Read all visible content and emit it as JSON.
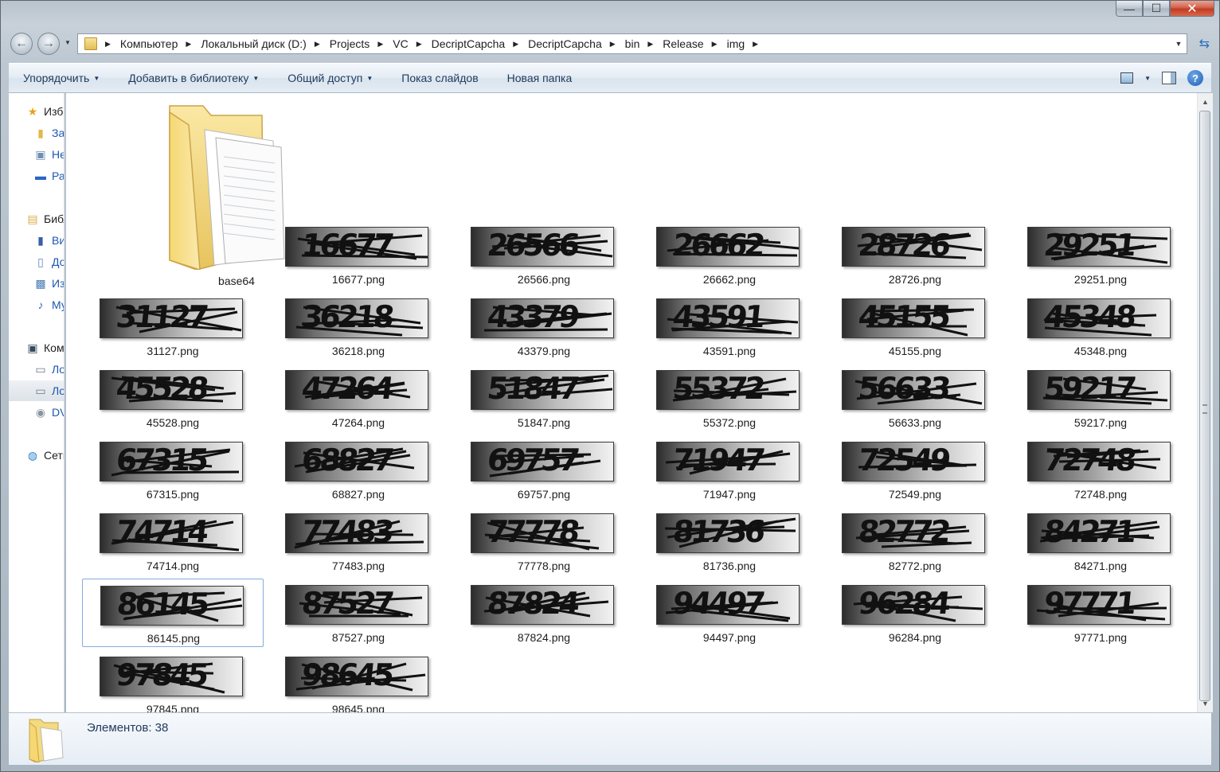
{
  "window": {
    "caption_buttons": {
      "minimize": "—",
      "maximize": "☐",
      "close": "✕"
    }
  },
  "address_bar": {
    "path": [
      "Компьютер",
      "Локальный диск (D:)",
      "Projects",
      "VC",
      "DecriptCapcha",
      "DecriptCapcha",
      "bin",
      "Release",
      "img"
    ]
  },
  "toolbar": {
    "organize": "Упорядочить",
    "add_to_library": "Добавить в библиотеку",
    "share": "Общий доступ",
    "slideshow": "Показ слайдов",
    "new_folder": "Новая папка"
  },
  "nav_pane": {
    "items": [
      {
        "label": "Избранное",
        "icon": "star-icon",
        "level": 0
      },
      {
        "label": "Загрузки",
        "icon": "downloads-folder-icon",
        "level": 1
      },
      {
        "label": "Недавние места",
        "icon": "recent-places-icon",
        "level": 1
      },
      {
        "label": "Рабочий стол",
        "icon": "desktop-icon",
        "level": 1
      },
      {
        "label": "Библиотеки",
        "icon": "libraries-icon",
        "level": 0
      },
      {
        "label": "Видео",
        "icon": "video-icon",
        "level": 1
      },
      {
        "label": "Документы",
        "icon": "documents-icon",
        "level": 1
      },
      {
        "label": "Изображения",
        "icon": "pictures-icon",
        "level": 1
      },
      {
        "label": "Музыка",
        "icon": "music-icon",
        "level": 1
      },
      {
        "label": "Компьютер",
        "icon": "computer-icon",
        "level": 0
      },
      {
        "label": "Локальный диск (C:)",
        "icon": "drive-icon",
        "level": 1
      },
      {
        "label": "Локальный диск (D:)",
        "icon": "drive-icon",
        "level": 1,
        "selected": true
      },
      {
        "label": "DVD RW дисковод",
        "icon": "dvd-drive-icon",
        "level": 1
      },
      {
        "label": "Сеть",
        "icon": "network-icon",
        "level": 0
      }
    ]
  },
  "folder": {
    "name": "base64",
    "icon": "folder-icon"
  },
  "files": [
    {
      "name": "16677.png",
      "captcha": "16677"
    },
    {
      "name": "26566.png",
      "captcha": "26566"
    },
    {
      "name": "26662.png",
      "captcha": "26662"
    },
    {
      "name": "28726.png",
      "captcha": "28726"
    },
    {
      "name": "29251.png",
      "captcha": "29251"
    },
    {
      "name": "31127.png",
      "captcha": "31127"
    },
    {
      "name": "36218.png",
      "captcha": "36218"
    },
    {
      "name": "43379.png",
      "captcha": "43379"
    },
    {
      "name": "43591.png",
      "captcha": "43591"
    },
    {
      "name": "45155.png",
      "captcha": "45155"
    },
    {
      "name": "45348.png",
      "captcha": "45348"
    },
    {
      "name": "45528.png",
      "captcha": "45528"
    },
    {
      "name": "47264.png",
      "captcha": "47264"
    },
    {
      "name": "51847.png",
      "captcha": "51847"
    },
    {
      "name": "55372.png",
      "captcha": "55372"
    },
    {
      "name": "56633.png",
      "captcha": "56633"
    },
    {
      "name": "59217.png",
      "captcha": "59217"
    },
    {
      "name": "67315.png",
      "captcha": "67315"
    },
    {
      "name": "68827.png",
      "captcha": "68827"
    },
    {
      "name": "69757.png",
      "captcha": "69757"
    },
    {
      "name": "71947.png",
      "captcha": "71947"
    },
    {
      "name": "72549.png",
      "captcha": "72549"
    },
    {
      "name": "72748.png",
      "captcha": "72748"
    },
    {
      "name": "74714.png",
      "captcha": "74714"
    },
    {
      "name": "77483.png",
      "captcha": "77483"
    },
    {
      "name": "77778.png",
      "captcha": "77778"
    },
    {
      "name": "81736.png",
      "captcha": "81736"
    },
    {
      "name": "82772.png",
      "captcha": "82772"
    },
    {
      "name": "84271.png",
      "captcha": "84271"
    },
    {
      "name": "86145.png",
      "captcha": "86145",
      "selected": true
    },
    {
      "name": "87527.png",
      "captcha": "87527"
    },
    {
      "name": "87824.png",
      "captcha": "87824"
    },
    {
      "name": "94497.png",
      "captcha": "94497"
    },
    {
      "name": "96284.png",
      "captcha": "96284"
    },
    {
      "name": "97771.png",
      "captcha": "97771"
    },
    {
      "name": "97845.png",
      "captcha": "97845"
    },
    {
      "name": "98645.png",
      "captcha": "98645"
    }
  ],
  "status_bar": {
    "count_text": "Элементов: 38"
  }
}
